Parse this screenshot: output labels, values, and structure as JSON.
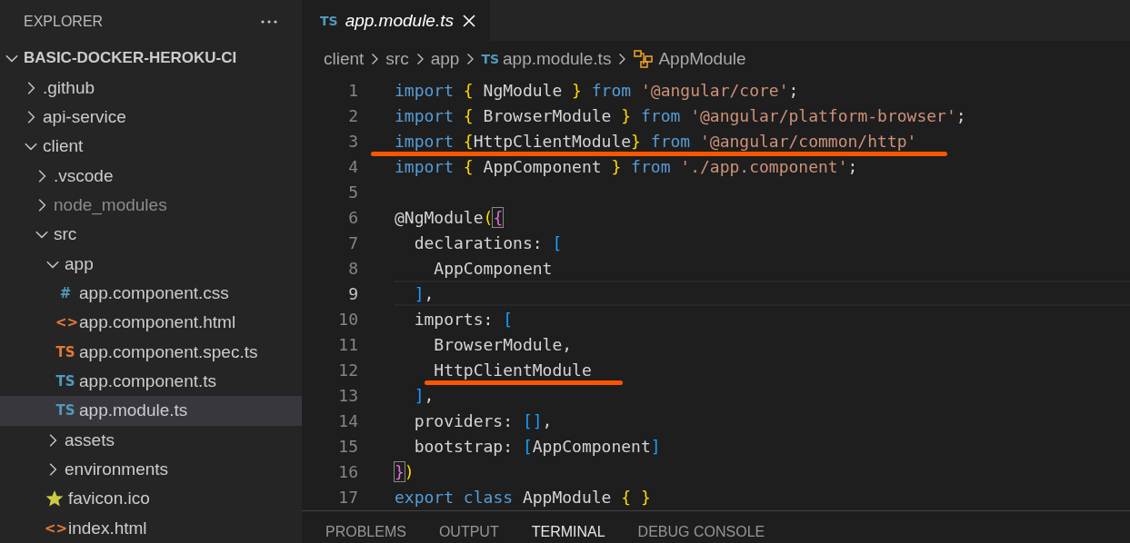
{
  "sidebar": {
    "title": "EXPLORER",
    "tree": [
      {
        "label": "BASIC-DOCKER-HEROKU-CI",
        "kind": "root",
        "expanded": true,
        "selected": false,
        "children": [
          {
            "label": ".github",
            "kind": "folder",
            "expanded": false,
            "selected": false
          },
          {
            "label": "api-service",
            "kind": "folder",
            "expanded": false,
            "selected": false
          },
          {
            "label": "client",
            "kind": "folder",
            "expanded": true,
            "selected": false,
            "children": [
              {
                "label": ".vscode",
                "kind": "folder",
                "expanded": false,
                "selected": false
              },
              {
                "label": "node_modules",
                "kind": "folder",
                "expanded": false,
                "selected": false,
                "ignored": true
              },
              {
                "label": "src",
                "kind": "folder",
                "expanded": true,
                "selected": false,
                "children": [
                  {
                    "label": "app",
                    "kind": "folder",
                    "expanded": true,
                    "selected": false,
                    "children": [
                      {
                        "label": "app.component.css",
                        "kind": "css",
                        "icon": "#",
                        "selected": false
                      },
                      {
                        "label": "app.component.html",
                        "kind": "html",
                        "icon": "<>",
                        "selected": false
                      },
                      {
                        "label": "app.component.spec.ts",
                        "kind": "spec",
                        "icon": "TS",
                        "selected": false
                      },
                      {
                        "label": "app.component.ts",
                        "kind": "ts",
                        "icon": "TS",
                        "selected": false
                      },
                      {
                        "label": "app.module.ts",
                        "kind": "ts",
                        "icon": "TS",
                        "selected": true
                      }
                    ]
                  },
                  {
                    "label": "assets",
                    "kind": "folder",
                    "expanded": false,
                    "selected": false
                  },
                  {
                    "label": "environments",
                    "kind": "folder",
                    "expanded": false,
                    "selected": false
                  },
                  {
                    "label": "favicon.ico",
                    "kind": "star",
                    "selected": false
                  },
                  {
                    "label": "index.html",
                    "kind": "html",
                    "icon": "<>",
                    "selected": false
                  }
                ]
              }
            ]
          }
        ]
      }
    ]
  },
  "tabs": [
    {
      "icon": "TS",
      "label": "app.module.ts",
      "selected": true
    }
  ],
  "breadcrumb": {
    "folders": [
      "client",
      "src",
      "app"
    ],
    "file_icon": "TS",
    "file": "app.module.ts",
    "symbol": "AppModule"
  },
  "code": [
    {
      "number": "1",
      "tokens": [
        {
          "t": "import",
          "kind": "keyword"
        },
        {
          "t": " {",
          "kind": "bracket"
        },
        {
          "t": " NgModule ",
          "kind": "plain"
        },
        {
          "t": "}",
          "kind": "bracket"
        },
        {
          "t": " from",
          "kind": "keyword"
        },
        {
          "t": " '@angular/core'",
          "kind": "string"
        },
        {
          "t": ";",
          "kind": "plain"
        }
      ]
    },
    {
      "number": "2",
      "tokens": [
        {
          "t": "import",
          "kind": "keyword"
        },
        {
          "t": " {",
          "kind": "bracket"
        },
        {
          "t": " BrowserModule ",
          "kind": "plain"
        },
        {
          "t": "}",
          "kind": "bracket"
        },
        {
          "t": " from",
          "kind": "keyword"
        },
        {
          "t": " '@angular/platform-browser'",
          "kind": "string"
        },
        {
          "t": ";",
          "kind": "plain"
        }
      ]
    },
    {
      "number": "3",
      "underlined": true,
      "tokens": [
        {
          "t": "import",
          "kind": "keyword"
        },
        {
          "t": " {",
          "kind": "bracket"
        },
        {
          "t": "HttpClientModule",
          "kind": "plain"
        },
        {
          "t": "}",
          "kind": "bracket"
        },
        {
          "t": " from",
          "kind": "keyword"
        },
        {
          "t": " '@angular/common/http'",
          "kind": "string"
        }
      ]
    },
    {
      "number": "4",
      "tokens": [
        {
          "t": "import",
          "kind": "keyword"
        },
        {
          "t": " {",
          "kind": "bracket"
        },
        {
          "t": " AppComponent ",
          "kind": "plain"
        },
        {
          "t": "}",
          "kind": "bracket"
        },
        {
          "t": " from",
          "kind": "keyword"
        },
        {
          "t": " './app.component'",
          "kind": "string"
        },
        {
          "t": ";",
          "kind": "plain"
        }
      ]
    },
    {
      "number": "5"
    },
    {
      "number": "6",
      "tokens": [
        {
          "t": "@NgModule",
          "kind": "plain"
        },
        {
          "t": "(",
          "kind": "bracket"
        },
        {
          "t": "{",
          "kind": "matched"
        }
      ]
    },
    {
      "number": "7",
      "tokens": [
        {
          "t": "  declarations: ",
          "kind": "plain"
        },
        {
          "t": "[",
          "kind": "square"
        }
      ]
    },
    {
      "number": "8",
      "tokens": [
        {
          "t": "    AppComponent",
          "kind": "plain"
        }
      ]
    },
    {
      "number": "9",
      "current": true,
      "tokens": [
        {
          "t": "  ]",
          "kind": "square"
        },
        {
          "t": ",",
          "kind": "plain"
        }
      ]
    },
    {
      "number": "10",
      "tokens": [
        {
          "t": "  imports: ",
          "kind": "plain"
        },
        {
          "t": "[",
          "kind": "square"
        }
      ]
    },
    {
      "number": "11",
      "tokens": [
        {
          "t": "    BrowserModule,",
          "kind": "plain"
        }
      ]
    },
    {
      "number": "12",
      "underlined": true,
      "tokens": [
        {
          "t": "    HttpClientModule",
          "kind": "plain"
        }
      ]
    },
    {
      "number": "13",
      "tokens": [
        {
          "t": "  ]",
          "kind": "square"
        },
        {
          "t": ",",
          "kind": "plain"
        }
      ]
    },
    {
      "number": "14",
      "tokens": [
        {
          "t": "  providers: ",
          "kind": "plain"
        },
        {
          "t": "[]",
          "kind": "square"
        },
        {
          "t": ",",
          "kind": "plain"
        }
      ]
    },
    {
      "number": "15",
      "tokens": [
        {
          "t": "  bootstrap: ",
          "kind": "plain"
        },
        {
          "t": "[",
          "kind": "square"
        },
        {
          "t": "AppComponent",
          "kind": "plain"
        },
        {
          "t": "]",
          "kind": "square"
        }
      ]
    },
    {
      "number": "16",
      "tokens": [
        {
          "t": "}",
          "kind": "matched"
        },
        {
          "t": ")",
          "kind": "bracket"
        }
      ]
    },
    {
      "number": "17",
      "tokens": [
        {
          "t": "export",
          "kind": "keyword"
        },
        {
          "t": " class",
          "kind": "keyword"
        },
        {
          "t": " AppModule ",
          "kind": "plain"
        },
        {
          "t": "{ }",
          "kind": "bracket"
        }
      ]
    }
  ],
  "panel_tabs": [
    {
      "label": "PROBLEMS",
      "selected": false
    },
    {
      "label": "OUTPUT",
      "selected": false
    },
    {
      "label": "TERMINAL",
      "selected": true
    },
    {
      "label": "DEBUG CONSOLE",
      "selected": false
    }
  ]
}
